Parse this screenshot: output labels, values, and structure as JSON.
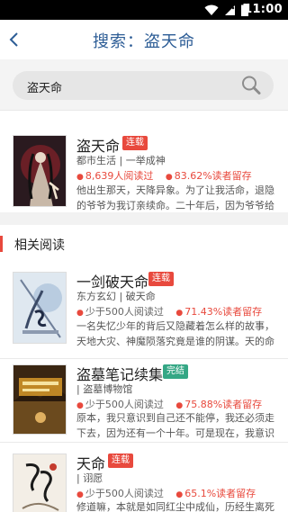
{
  "status_bar": {
    "time": "11:00"
  },
  "header": {
    "title": "搜索：盗天命"
  },
  "search": {
    "query": "盗天命"
  },
  "result": {
    "title": "盗天命",
    "tag": "连载",
    "genre": "都市生活",
    "author": "一举成神",
    "reads": "8,639人阅读过",
    "retention": "83.62%读者留存",
    "description": "他出生那天，天降异象。为了让我活命，退隐的爷爷为我订亲续命。二十年后，因为爷爷给的一"
  },
  "related": {
    "heading": "相关阅读",
    "books": [
      {
        "title": "一剑破天命",
        "tag": "连载",
        "tag_type": "serial",
        "genre": "东方玄幻",
        "author": "破天命",
        "reads": "少于500人阅读过",
        "retention": "71.43%读者留存",
        "description": "一名失忆少年的背后又隐藏着怎么样的故事，天地大灾、神魔陨落究竟是谁的阴谋。天的命"
      },
      {
        "title": "盗墓笔记续集",
        "tag": "完结",
        "tag_type": "done",
        "genre": "",
        "author": "盗墓博物馆",
        "reads": "少于500人阅读过",
        "retention": "75.88%读者留存",
        "description": "原本，我只意识到自己还不能停，我还必须走下去，因为还有一个十年。可是现在，我意识到其他"
      },
      {
        "title": "天命",
        "tag": "连载",
        "tag_type": "serial",
        "genre": "",
        "author": "诩愿",
        "reads": "少于500人阅读过",
        "retention": "65.1%读者留存",
        "description": "修道嘛，本就是如同红尘中成仙，历经生离死"
      }
    ]
  },
  "colors": {
    "accent_blue": "#2d5d96",
    "red": "#e8493d",
    "green": "#35a785"
  }
}
